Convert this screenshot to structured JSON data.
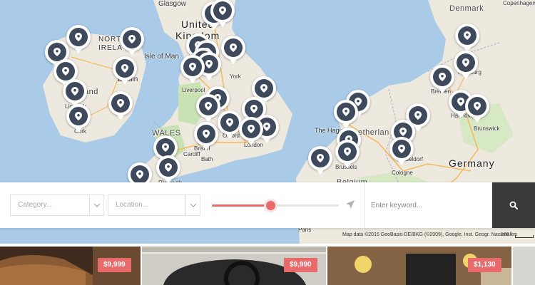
{
  "map": {
    "labels": {
      "glasgow": "Glasgow",
      "united_kingdom": "United\nKingdom",
      "northern_ireland": "NORTH\nIRELA",
      "isle_of_man": "Isle of Man",
      "ireland": "and",
      "dublin": "Dublin",
      "limerick": "Limerick",
      "cork": "Cork",
      "york": "York",
      "liverpool": "Liverpool",
      "wales": "WALES",
      "oxford": "Oxford",
      "london": "London",
      "bristol": "Bristol",
      "cardiff": "Cardiff",
      "bath": "Bath",
      "plymouth": "Plymouth",
      "denmark": "Denmark",
      "copenhagen": "Copenhagen",
      "hamburg": "Hamburg",
      "bremen": "Bremen",
      "hannover": "Hannover",
      "brunswick": "Brunswick",
      "the_hague": "The Hague",
      "netherlands": "etherlan",
      "brussels": "Brussels",
      "dusseldorf": "sseldorf",
      "cologne": "Cologne",
      "belgium": "Belgium",
      "germany": "Germany",
      "paris": "Paris"
    },
    "attribution": "Map data ©2015 GeoBasis-DE/BKG (©2009), Google, Inst. Geogr. Nacional",
    "scale": "100 km",
    "pin_icon": "map-marker-icon",
    "pin_color": "#3e4a5c"
  },
  "search": {
    "category_placeholder": "Category...",
    "location_placeholder": "Location...",
    "distance_fraction": 0.46,
    "keyword_placeholder": "Enter keyword...",
    "search_icon": "search-icon",
    "accent_color": "#e86a6a"
  },
  "listings": [
    {
      "price": "$9,999"
    },
    {
      "price": "$9,990"
    },
    {
      "price": "$1,130"
    }
  ]
}
